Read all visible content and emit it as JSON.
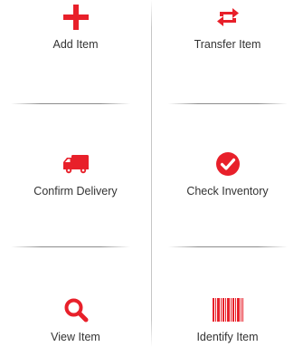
{
  "colors": {
    "accent": "#e8202a",
    "label": "#333333",
    "divider": "#9a9a9a"
  },
  "tiles": [
    {
      "label": "Add Item",
      "icon": "plus-icon"
    },
    {
      "label": "Transfer Item",
      "icon": "transfer-icon"
    },
    {
      "label": "Confirm Delivery",
      "icon": "truck-icon"
    },
    {
      "label": "Check Inventory",
      "icon": "check-circle-icon"
    },
    {
      "label": "View Item",
      "icon": "search-icon"
    },
    {
      "label": "Identify Item",
      "icon": "barcode-icon"
    }
  ]
}
